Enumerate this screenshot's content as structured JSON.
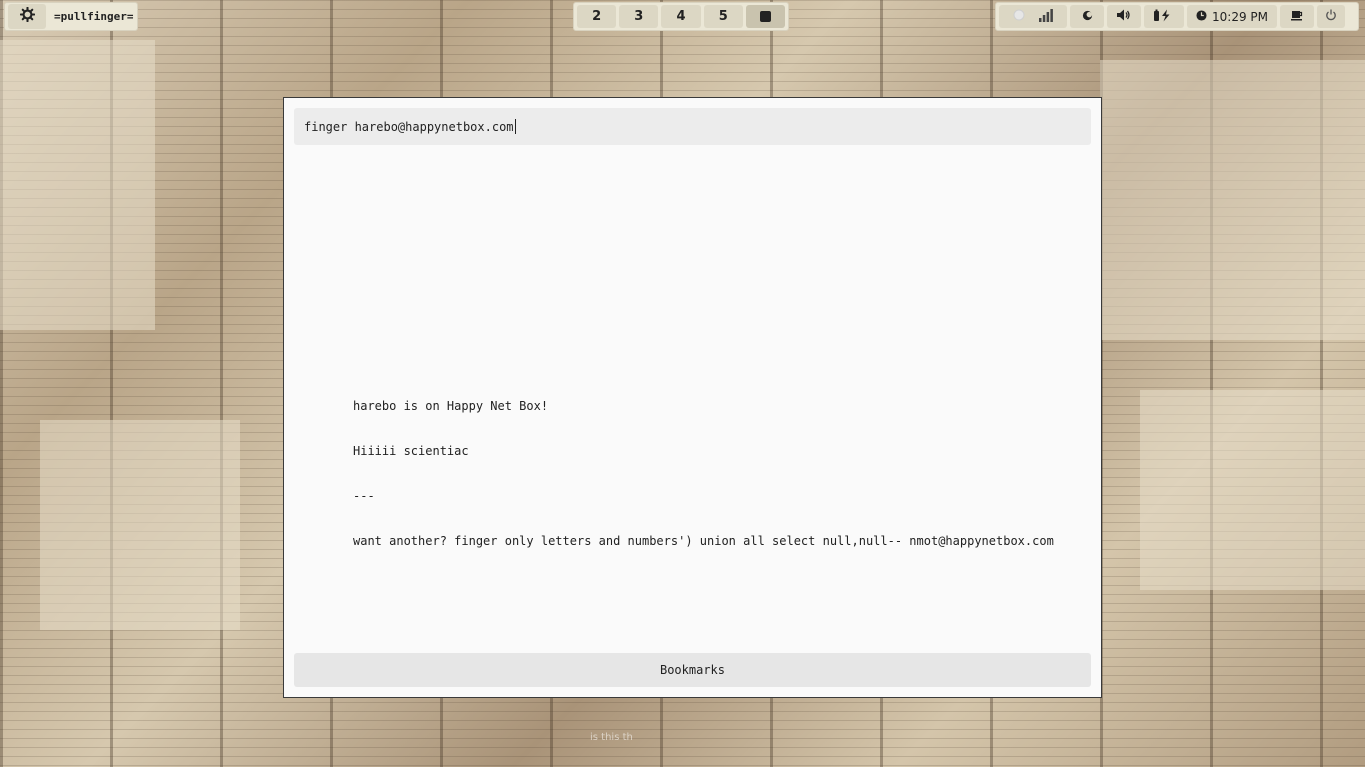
{
  "top_left": {
    "launcher_icon": "gear-icon",
    "label": "=pullfinger="
  },
  "workspaces": [
    {
      "label": "2"
    },
    {
      "label": "3"
    },
    {
      "label": "4"
    },
    {
      "label": "5"
    }
  ],
  "system_tray": {
    "icons": [
      "brightness-icon",
      "network-signal-icon",
      "night-light-icon",
      "volume-icon",
      "battery-charging-icon"
    ],
    "clock": "10:29 PM",
    "extra_icons": [
      "coffee-icon",
      "power-icon"
    ]
  },
  "dialog": {
    "query": "finger harebo@happynetbox.com",
    "output_lines": [
      "harebo is on Happy Net Box!",
      "Hiiiii scientiac",
      "---",
      "want another? finger only letters and numbers') union all select null,null-- nmot@happynetbox.com"
    ],
    "bookmarks_label": "Bookmarks"
  },
  "background_caption": "is this th"
}
